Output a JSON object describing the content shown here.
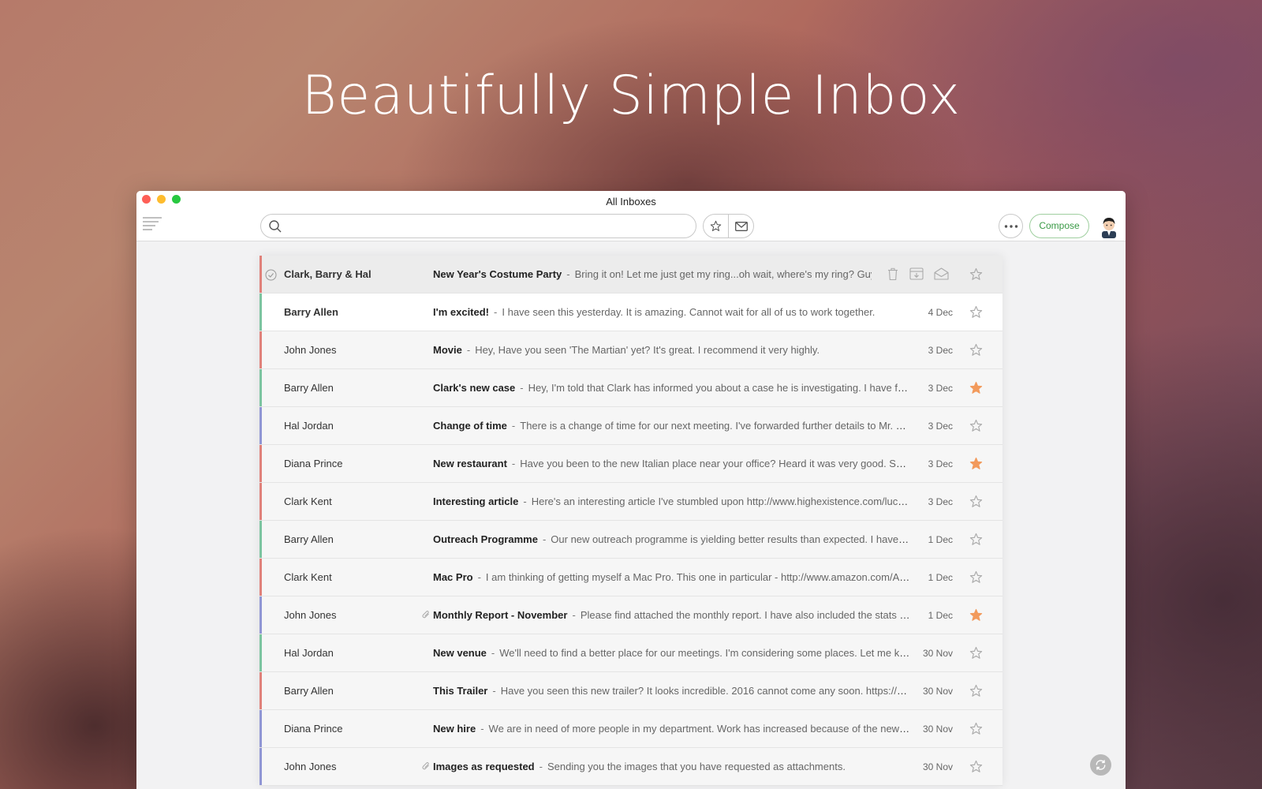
{
  "hero": {
    "title": "Beautifully Simple Inbox"
  },
  "window": {
    "title": "All Inboxes"
  },
  "search": {
    "placeholder": ""
  },
  "toolbar": {
    "compose_label": "Compose"
  },
  "colors": {
    "red": "#e0817a",
    "green": "#7cc4a0",
    "blue": "#9096d4",
    "star": "#f29a5c",
    "compose": "#3a9a46"
  },
  "emails": [
    {
      "from": "Clark, Barry & Hal",
      "subject": "New Year's Costume Party",
      "snippet": "Bring it on! Let me just get my ring...oh wait, where's my ring? Guy",
      "date": "",
      "starred": false,
      "tag": "red",
      "state": "hover",
      "attachment": false
    },
    {
      "from": "Barry Allen",
      "subject": "I'm excited!",
      "snippet": "I have seen this yesterday. It is amazing. Cannot wait for all of us to work together.",
      "date": "4 Dec",
      "starred": false,
      "tag": "green",
      "state": "unread",
      "attachment": false
    },
    {
      "from": "John Jones",
      "subject": "Movie",
      "snippet": "Hey, Have you seen 'The Martian' yet? It's great. I recommend it very highly.",
      "date": "3 Dec",
      "starred": false,
      "tag": "red",
      "state": "read",
      "attachment": false
    },
    {
      "from": "Barry Allen",
      "subject": "Clark's new case",
      "snippet": "Hey, I'm told that Clark has informed you about a case he is investigating. I have found some leads.",
      "date": "3 Dec",
      "starred": true,
      "tag": "green",
      "state": "read",
      "attachment": false
    },
    {
      "from": "Hal Jordan",
      "subject": "Change of time",
      "snippet": "There is a change of time for our next meeting. I've forwarded further details to Mr. Fox.",
      "date": "3 Dec",
      "starred": false,
      "tag": "blue",
      "state": "read",
      "attachment": false
    },
    {
      "from": "Diana Prince",
      "subject": "New restaurant",
      "snippet": "Have you been to the new Italian place near your office? Heard it was very good. Sent you the menu.",
      "date": "3 Dec",
      "starred": true,
      "tag": "red",
      "state": "read",
      "attachment": false
    },
    {
      "from": "Clark Kent",
      "subject": "Interesting article",
      "snippet": "Here's an interesting article I've stumbled upon http://www.highexistence.com/lucid-dreaming",
      "date": "3 Dec",
      "starred": false,
      "tag": "red",
      "state": "read",
      "attachment": false
    },
    {
      "from": "Barry Allen",
      "subject": "Outreach Programme",
      "snippet": "Our new outreach programme is yielding better results than expected. I have sent the numbers.",
      "date": "1 Dec",
      "starred": false,
      "tag": "green",
      "state": "read",
      "attachment": false
    },
    {
      "from": "Clark Kent",
      "subject": "Mac Pro",
      "snippet": "I am thinking of getting myself a Mac Pro. This one in particular - http://www.amazon.com/Apple-Mac-Pro",
      "date": "1 Dec",
      "starred": false,
      "tag": "red",
      "state": "read",
      "attachment": false
    },
    {
      "from": "John Jones",
      "subject": "Monthly Report - November",
      "snippet": "Please find attached the monthly report. I have also included the stats report for October.",
      "date": "1 Dec",
      "starred": true,
      "tag": "blue",
      "state": "read",
      "attachment": true
    },
    {
      "from": "Hal Jordan",
      "subject": "New venue",
      "snippet": "We'll need to find a better place for our meetings. I'm considering some places. Let me know.",
      "date": "30 Nov",
      "starred": false,
      "tag": "green",
      "state": "read",
      "attachment": false
    },
    {
      "from": "Barry Allen",
      "subject": "This Trailer",
      "snippet": "Have you seen this new trailer? It looks incredible. 2016 cannot come any soon. https://www.youtube.com",
      "date": "30 Nov",
      "starred": false,
      "tag": "red",
      "state": "read",
      "attachment": false
    },
    {
      "from": "Diana Prince",
      "subject": "New hire",
      "snippet": "We are in need of more people in my department. Work has increased because of the new venture.",
      "date": "30 Nov",
      "starred": false,
      "tag": "blue",
      "state": "read",
      "attachment": false
    },
    {
      "from": "John Jones",
      "subject": "Images as requested",
      "snippet": "Sending you the images that you have requested as attachments.",
      "date": "30 Nov",
      "starred": false,
      "tag": "blue",
      "state": "read",
      "attachment": true
    }
  ]
}
